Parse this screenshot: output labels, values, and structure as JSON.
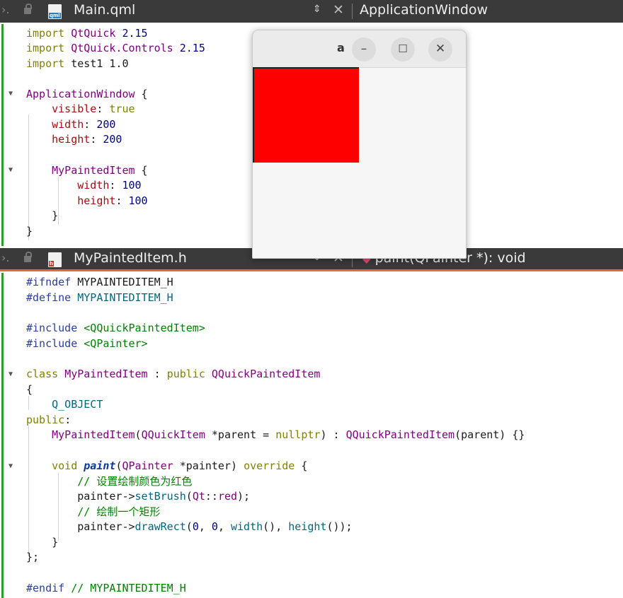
{
  "top_tab": {
    "nav": "›.",
    "file_icon": "qml",
    "file_name": "Main.qml",
    "updown": "⇕",
    "close": "✕",
    "symbol": "ApplicationWindow"
  },
  "qml_code": [
    "import QtQuick 2.15",
    "import QtQuick.Controls 2.15",
    "import test1 1.0",
    "",
    "ApplicationWindow {",
    "    visible: true",
    "    width: 200",
    "    height: 200",
    "",
    "    MyPaintedItem {",
    "        width: 100",
    "        height: 100",
    "    }",
    "}"
  ],
  "bottom_tab": {
    "nav": "›.",
    "file_icon": "h",
    "file_name": "MyPaintedItem.h",
    "updown": "⇕",
    "close": "✕",
    "symbol": "paint(QPainter *): void"
  },
  "cpp_code": [
    "#ifndef MYPAINTEDITEM_H",
    "#define MYPAINTEDITEM_H",
    "",
    "#include <QQuickPaintedItem>",
    "#include <QPainter>",
    "",
    "class MyPaintedItem : public QQuickPaintedItem",
    "{",
    "    Q_OBJECT",
    "public:",
    "    MyPaintedItem(QQuickItem *parent = nullptr) : QQuickPaintedItem(parent) {}",
    "",
    "    void paint(QPainter *painter) override {",
    "        // 设置绘制颜色为红色",
    "        painter->setBrush(Qt::red);",
    "        // 绘制一个矩形",
    "        painter->drawRect(0, 0, width(), height());",
    "    }",
    "};",
    "",
    "#endif // MYPAINTEDITEM_H"
  ],
  "app_window": {
    "title": "a",
    "minimize": "–",
    "maximize": "☐",
    "close": "✕",
    "rect_color": "#ff0000"
  },
  "colors": {
    "accent_orange": "#e36b30",
    "gutter_green": "#2e9b2e",
    "tabbar_bg": "#3a3a3a"
  }
}
